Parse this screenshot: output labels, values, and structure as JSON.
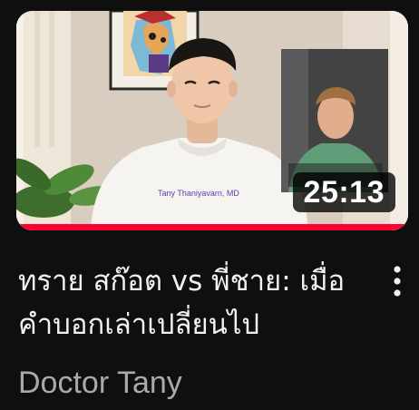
{
  "video": {
    "title": "ทราย สก๊อต vs พี่ชาย: เมื่อคำบอกเล่าเปลี่ยนไป",
    "channel": "Doctor Tany",
    "duration": "25:13",
    "shirt_text": "Tany Thaniyavarn, MD",
    "watch_progress": 1.0
  },
  "icons": {
    "menu": "more-vert-icon"
  },
  "colors": {
    "background": "#0f0f0f",
    "progress": "#ff0033",
    "title": "#f1f1f1",
    "channel": "#aaaaaa"
  }
}
